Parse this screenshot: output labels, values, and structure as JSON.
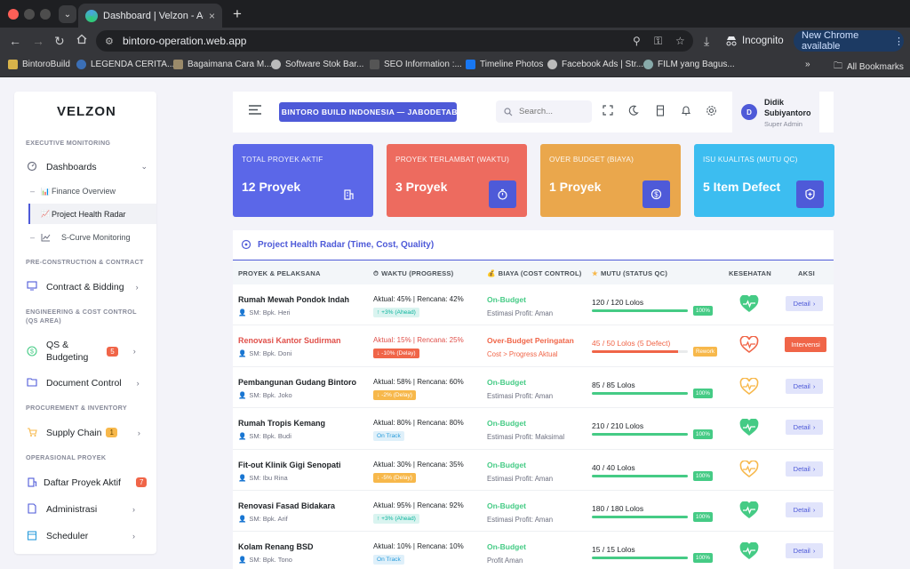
{
  "browser": {
    "tab_title": "Dashboard | Velzon - Admin & D",
    "url": "bintoro-operation.web.app",
    "incognito_label": "Incognito",
    "new_chrome_label": "New Chrome available",
    "bookmarks": [
      "BintoroBuild",
      "LEGENDA CERITA...",
      "Bagaimana Cara M...",
      "Software Stok Bar...",
      "SEO Information :...",
      "Timeline Photos",
      "Facebook Ads | Str...",
      "FILM yang Bagus..."
    ],
    "all_bookmarks_label": "All Bookmarks"
  },
  "sidebar": {
    "logo": "VELZON",
    "sections": {
      "exec": "EXECUTIVE MONITORING",
      "precon": "PRE-CONSTRUCTION & CONTRACT",
      "eng": "ENGINEERING & COST CONTROL (QS AREA)",
      "proc": "PROCUREMENT & INVENTORY",
      "ops": "OPERASIONAL PROYEK"
    },
    "items": {
      "dashboards": "Dashboards",
      "finance": "Finance Overview",
      "radar": "Project Health Radar",
      "scurve": "S-Curve Monitoring",
      "contract": "Contract & Bidding",
      "qs": "QS &\nBudgeting",
      "qs_badge": "5",
      "docs": "Document Control",
      "supply": "Supply Chain",
      "supply_badge": "1",
      "proyek": "Daftar Proyek Aktif",
      "proyek_badge": "7",
      "admin": "Administrasi",
      "scheduler": "Scheduler"
    }
  },
  "topbar": {
    "company": "PT. BINTORO BUILD INDONESIA — JABODETABEK",
    "search_placeholder": "Search...",
    "user_name": "Didik Subiyantoro",
    "user_role": "Super Admin",
    "avatar_initial": "D"
  },
  "cards": [
    {
      "label": "TOTAL PROYEK AKTIF",
      "value": "12 Proyek",
      "color": "#5b67e8",
      "icon": "building-icon"
    },
    {
      "label": "PROYEK TERLAMBAT (WAKTU)",
      "value": "3 Proyek",
      "color": "#ed6b5f",
      "icon": "stopwatch-icon"
    },
    {
      "label": "OVER BUDGET (BIAYA)",
      "value": "1 Proyek",
      "color": "#eaa74c",
      "icon": "dollar-icon"
    },
    {
      "label": "ISU KUALITAS (MUTU QC)",
      "value": "5 Item Defect",
      "color": "#3cbdf0",
      "icon": "shield-plus-icon"
    }
  ],
  "radar": {
    "title": "Project Health Radar (Time, Cost, Quality)",
    "headers": {
      "proyek": "PROYEK & PELAKSANA",
      "waktu": "WAKTU (PROGRESS)",
      "biaya": "BIAYA (COST CONTROL)",
      "mutu": "MUTU (STATUS QC)",
      "kesehatan": "KESEHATAN",
      "aksi": "AKSI"
    },
    "rows": [
      {
        "name": "Rumah Mewah Pondok Indah",
        "sm": "SM: Bpk. Heri",
        "waktu": "Aktual: 45% | Rencana: 42%",
        "tag": "+3% (Ahead)",
        "tag_kind": "ahead",
        "biaya": "On-Budget",
        "biaya_kind": "ok",
        "biaya_note": "Estimasi Profit: Aman",
        "qc": "120 / 120 Lolos",
        "qc_fraction": 1.0,
        "qc_tag": "100%",
        "qc_kind": "ok",
        "health": "good",
        "action": "Detail",
        "late": false
      },
      {
        "name": "Renovasi Kantor Sudirman",
        "sm": "SM: Bpk. Doni",
        "waktu": "Aktual: 15% | Rencana: 25%",
        "tag": "-10% (Delay)",
        "tag_kind": "delay-red",
        "biaya": "Over-Budget Peringatan",
        "biaya_kind": "bad",
        "biaya_note": "Cost > Progress Aktual",
        "qc": "45 / 50 Lolos (5 Defect)",
        "qc_fraction": 0.9,
        "qc_tag": "Rework",
        "qc_kind": "rework",
        "health": "bad",
        "action": "Intervensi",
        "late": true
      },
      {
        "name": "Pembangunan Gudang Bintoro",
        "sm": "SM: Bpk. Joko",
        "waktu": "Aktual: 58% | Rencana: 60%",
        "tag": "-2% (Delay)",
        "tag_kind": "delay-orange",
        "biaya": "On-Budget",
        "biaya_kind": "ok",
        "biaya_note": "Estimasi Profit: Aman",
        "qc": "85 / 85 Lolos",
        "qc_fraction": 1.0,
        "qc_tag": "100%",
        "qc_kind": "ok",
        "health": "warn",
        "action": "Detail",
        "late": false
      },
      {
        "name": "Rumah Tropis Kemang",
        "sm": "SM: Bpk. Budi",
        "waktu": "Aktual: 80% | Rencana: 80%",
        "tag": "On Track",
        "tag_kind": "ontrack",
        "biaya": "On-Budget",
        "biaya_kind": "ok",
        "biaya_note": "Estimasi Profit: Maksimal",
        "qc": "210 / 210 Lolos",
        "qc_fraction": 1.0,
        "qc_tag": "100%",
        "qc_kind": "ok",
        "health": "good",
        "action": "Detail",
        "late": false
      },
      {
        "name": "Fit-out Klinik Gigi Senopati",
        "sm": "SM: Ibu Rina",
        "waktu": "Aktual: 30% | Rencana: 35%",
        "tag": "-5% (Delay)",
        "tag_kind": "delay-orange",
        "biaya": "On-Budget",
        "biaya_kind": "ok",
        "biaya_note": "Estimasi Profit: Aman",
        "qc": "40 / 40 Lolos",
        "qc_fraction": 1.0,
        "qc_tag": "100%",
        "qc_kind": "ok",
        "health": "warn",
        "action": "Detail",
        "late": false
      },
      {
        "name": "Renovasi Fasad Bidakara",
        "sm": "SM: Bpk. Arif",
        "waktu": "Aktual: 95% | Rencana: 92%",
        "tag": "+3% (Ahead)",
        "tag_kind": "ahead",
        "biaya": "On-Budget",
        "biaya_kind": "ok",
        "biaya_note": "Estimasi Profit: Aman",
        "qc": "180 / 180 Lolos",
        "qc_fraction": 1.0,
        "qc_tag": "100%",
        "qc_kind": "ok",
        "health": "good",
        "action": "Detail",
        "late": false
      },
      {
        "name": "Kolam Renang BSD",
        "sm": "SM: Bpk. Tono",
        "waktu": "Aktual: 10% | Rencana: 10%",
        "tag": "On Track",
        "tag_kind": "ontrack",
        "biaya": "On-Budget",
        "biaya_kind": "ok",
        "biaya_note": "Profit Aman",
        "qc": "15 / 15 Lolos",
        "qc_fraction": 1.0,
        "qc_tag": "100%",
        "qc_kind": "ok",
        "health": "good",
        "action": "Detail",
        "late": false
      }
    ]
  },
  "colors": {
    "primary": "#4e5ad8",
    "success": "#45cb85",
    "danger": "#f06548",
    "warning": "#f7b84b",
    "info": "#299cdb",
    "text_danger": "#e0504a"
  }
}
